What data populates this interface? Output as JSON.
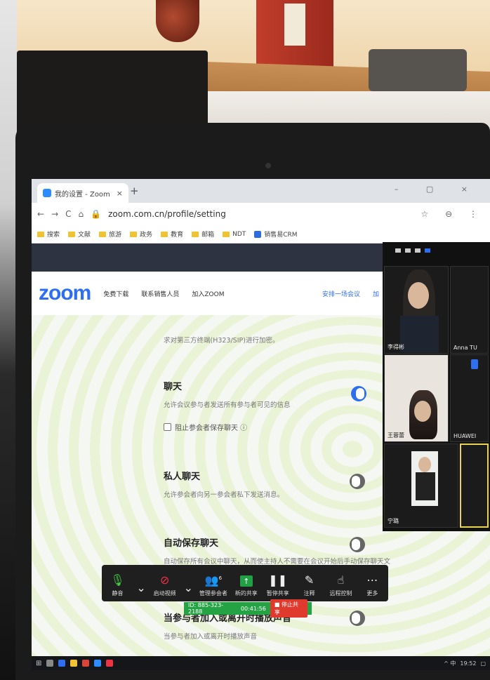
{
  "browser": {
    "tab_title": "我的设置 - Zoom",
    "tab_close": "×",
    "new_tab": "+",
    "nav": [
      "←",
      "→",
      "C",
      "⌂"
    ],
    "url": "zoom.com.cn/profile/setting",
    "window_controls": "– ▢ ×",
    "right_icons": "☆ ⊖ ⋮",
    "bookmarks": [
      {
        "label": "搜索",
        "kind": "folder"
      },
      {
        "label": "文献",
        "kind": "folder"
      },
      {
        "label": "旅游",
        "kind": "folder"
      },
      {
        "label": "政务",
        "kind": "folder"
      },
      {
        "label": "教育",
        "kind": "folder"
      },
      {
        "label": "邮箱",
        "kind": "folder"
      },
      {
        "label": "NDT",
        "kind": "folder"
      },
      {
        "label": "销售易CRM",
        "kind": "app"
      }
    ]
  },
  "zoom_nav": {
    "logo": "zoom",
    "links": [
      "免费下载",
      "联系销售人员",
      "加入ZOOM"
    ],
    "right_link": "安排一场会议",
    "right_link_cut": "加"
  },
  "settings": [
    {
      "title": "",
      "desc": "求对第三方终端(H323/SIP)进行加密。"
    },
    {
      "title": "聊天",
      "desc": "允许会议参与者发送所有参与者可见的信息",
      "toggle": "on",
      "checkbox": "阻止参会者保存聊天 ⓘ"
    },
    {
      "title": "私人聊天",
      "desc": "允许参会者向另一参会者私下发送消息。",
      "toggle": "off"
    },
    {
      "title": "自动保存聊天",
      "desc": "自动保存所有会议中聊天，从而使主持人不需要在会议开始后手动保存聊天文",
      "toggle": "off"
    },
    {
      "title": "当参与者加入或离开时播放声音",
      "desc": "当参与者加入或离开时播放声音",
      "toggle": "off"
    }
  ],
  "gallery": {
    "tiles": [
      {
        "name": "李得彬"
      },
      {
        "name": "Anna TU"
      },
      {
        "name": "王蓉蕾"
      },
      {
        "name": "HUAWEI"
      },
      {
        "name": "宁璐"
      }
    ]
  },
  "meeting_toolbar": {
    "buttons": [
      {
        "label": "静音",
        "icon": "microphone-icon",
        "glyph": "🎙"
      },
      {
        "label": "",
        "icon": "chevron-up-icon",
        "glyph": "⌄"
      },
      {
        "label": "启动视频",
        "icon": "video-off-icon",
        "glyph": "⊘"
      },
      {
        "label": "",
        "icon": "chevron-up-icon",
        "glyph": "⌄"
      },
      {
        "label": "管理参会者",
        "icon": "participants-icon",
        "glyph": "👥",
        "badge": "6"
      },
      {
        "label": "新的共享",
        "icon": "share-screen-icon",
        "glyph": "↑"
      },
      {
        "label": "暂停共享",
        "icon": "pause-icon",
        "glyph": "❚❚"
      },
      {
        "label": "注释",
        "icon": "pen-icon",
        "glyph": "✎"
      },
      {
        "label": "远程控制",
        "icon": "remote-control-icon",
        "glyph": "☝"
      },
      {
        "label": "更多",
        "icon": "more-icon",
        "glyph": "⋯"
      }
    ],
    "meeting_id": "ID: 885-323-2188",
    "timer": "00:41:56",
    "stop_share": "■ 停止共享"
  },
  "taskbar": {
    "tray_text": "^ 中",
    "time": "19:52"
  },
  "colors": {
    "zoom_blue": "#2d6ff0",
    "share_green": "#25a244",
    "stop_red": "#e03a2f"
  }
}
